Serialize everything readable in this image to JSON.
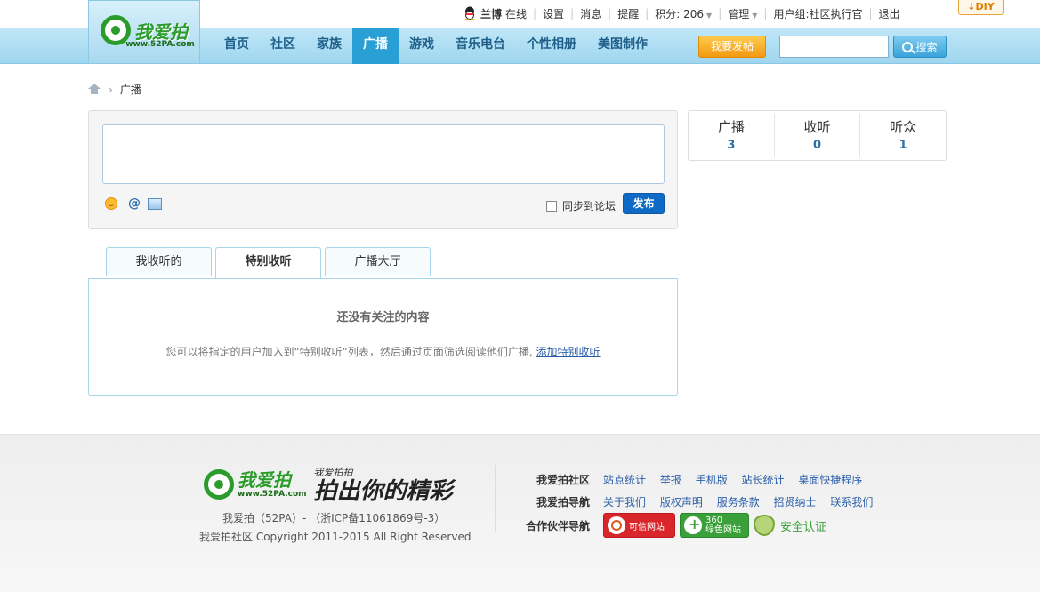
{
  "topbar": {
    "username": "兰博",
    "online": "在线",
    "links": [
      "设置",
      "消息",
      "提醒"
    ],
    "score_label": "积分: 206",
    "manage_label": "管理",
    "usergroup": "用户组:社区执行官",
    "logout": "退出",
    "diy": "DIY"
  },
  "logo": {
    "text": "我爱拍",
    "url": "www.52PA.com"
  },
  "nav": {
    "items": [
      {
        "label": "首页"
      },
      {
        "label": "社区"
      },
      {
        "label": "家族"
      },
      {
        "label": "广播",
        "active": true
      },
      {
        "label": "游戏"
      },
      {
        "label": "音乐电台"
      },
      {
        "label": "个性相册"
      },
      {
        "label": "美图制作"
      }
    ],
    "post_button": "我要发帖",
    "search_button": "搜索"
  },
  "breadcrumb": {
    "current": "广播"
  },
  "compose": {
    "sync_label": "同步到论坛",
    "publish_label": "发布"
  },
  "stats": [
    {
      "label": "广播",
      "value": "3"
    },
    {
      "label": "收听",
      "value": "0"
    },
    {
      "label": "听众",
      "value": "1"
    }
  ],
  "tabs": [
    {
      "label": "我收听的"
    },
    {
      "label": "特别收听",
      "active": true
    },
    {
      "label": "广播大厅"
    }
  ],
  "panel": {
    "empty_title": "还没有关注的内容",
    "empty_desc": "您可以将指定的用户加入到“特别收听”列表，然后通过页面筛选阅读他们广播, ",
    "empty_link": "添加特别收听"
  },
  "footer": {
    "logo_text": "我爱拍",
    "logo_url": "www.52PA.com",
    "slogan_small": "我爱拍拍",
    "slogan_big": "拍出你的精彩",
    "info1": "我爱拍（52PA）-  （浙ICP备11061869号-3）",
    "info2": "我爱拍社区   Copyright 2011-2015 All Right Reserved",
    "rows": [
      {
        "heading": "我爱拍社区",
        "links": [
          "站点统计",
          "举报",
          "手机版",
          "站长统计",
          "桌面快捷程序"
        ]
      },
      {
        "heading": "我爱拍导航",
        "links": [
          "关于我们",
          "版权声明",
          "服务条款",
          "招贤纳士",
          "联系我们"
        ]
      }
    ],
    "partner_heading": "合作伙伴导航",
    "badge1": "可信网站",
    "badge2_top": "360",
    "badge2": "绿色网站",
    "secure_label": "安全认证"
  }
}
